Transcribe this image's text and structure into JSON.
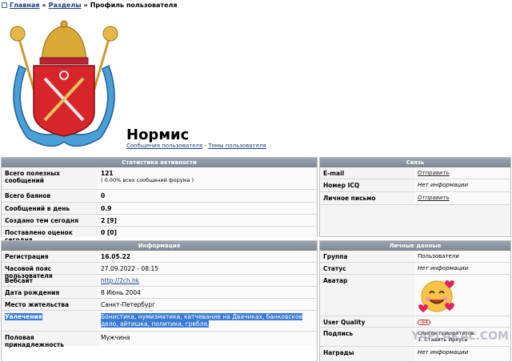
{
  "breadcrumb": {
    "home": "Главная",
    "sections": "Разделы",
    "sep": "»",
    "current": "Профиль пользователя"
  },
  "profile": {
    "name": "Нормис",
    "posts_link": "Сообщения пользователя",
    "topics_link": "Темы пользователя",
    "sep": "-"
  },
  "stats": {
    "header": "Статистика активности",
    "rows": [
      {
        "k": "Всего полезных сообщений",
        "v": "121",
        "sub": "( 0.00% всех сообщений форума )"
      },
      {
        "k": "Всего баянов",
        "v": "0"
      },
      {
        "k": "Сообщений в день",
        "v": "0.9"
      },
      {
        "k": "Создано тем сегодня",
        "v": "2 [9]"
      },
      {
        "k": "Поставлено оценок сегодня",
        "v": "0 [0]"
      }
    ]
  },
  "info": {
    "header": "Информация",
    "rows": [
      {
        "k": "Регистрация",
        "v": "16.05.22"
      },
      {
        "k": "Часовой пояс пользователя",
        "v": "27.09.2022 - 08:15"
      },
      {
        "k": "Вебсайт",
        "v": "http://2ch.hk"
      },
      {
        "k": "Дата рождения",
        "v": "8 Июнь 2004"
      },
      {
        "k": "Место жительства",
        "v": "Санкт-Петербург"
      },
      {
        "k": "Увлечения",
        "v": "Бонистика, нумизматика, катчевание на Двачиках, банковское дело, айтишка, политика, гребля."
      },
      {
        "k": "Половая принадлежность",
        "v": "Мужчина"
      }
    ]
  },
  "contact": {
    "header": "Связь",
    "rows": [
      {
        "k": "E-mail",
        "v": "Отправить"
      },
      {
        "k": "Номер ICQ",
        "v": "Нет информации"
      },
      {
        "k": "Личное письмо",
        "v": "Отправить"
      }
    ]
  },
  "personal": {
    "header": "Личные данные",
    "rows": [
      {
        "k": "Группа",
        "v": "Пользователи"
      },
      {
        "k": "Статус",
        "v": "Нет информации"
      },
      {
        "k": "Аватар",
        "v": ""
      },
      {
        "k": "User Quality",
        "v": "-54"
      },
      {
        "k": "Подпись",
        "v": "Список приоритетов:",
        "v2": "1. Ставить Иркусь"
      },
      {
        "k": "Награды",
        "v": "Нет информации"
      }
    ]
  },
  "watermark": "YAPLAKAL.COM",
  "colors": {
    "header_bg": "#8a95a1",
    "highlight": "#3a7bd5",
    "link": "#1a3f7a"
  }
}
